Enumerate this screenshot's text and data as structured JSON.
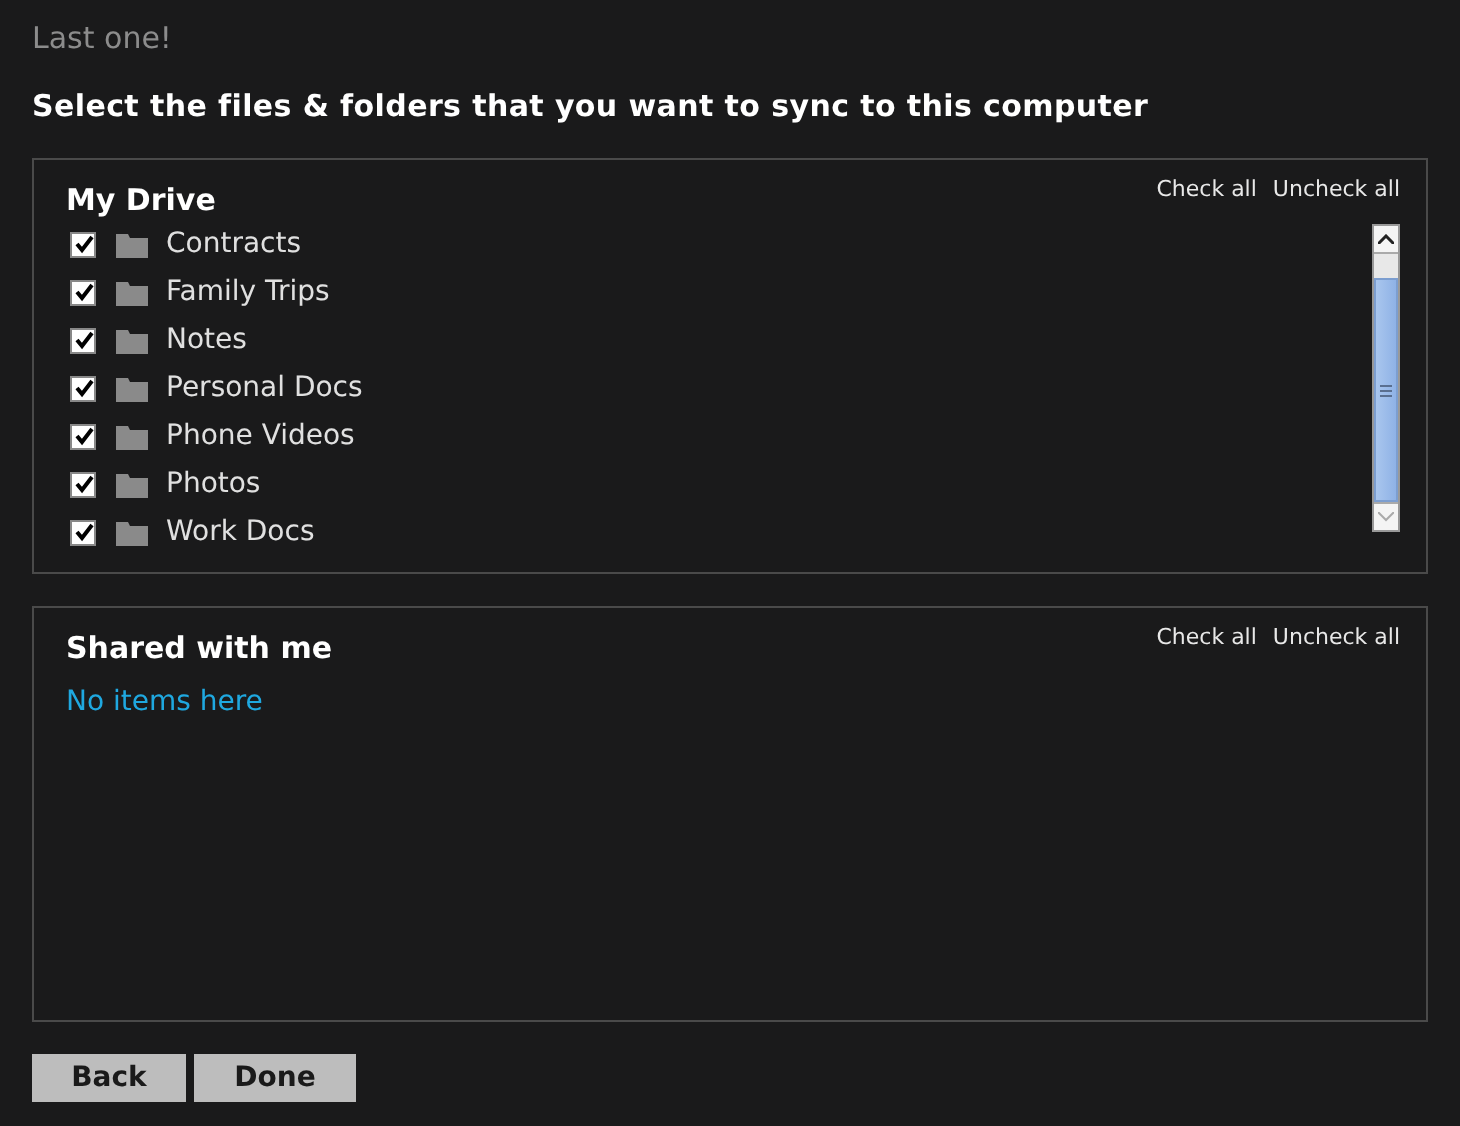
{
  "step_label": "Last one!",
  "heading": "Select the files & folders that you want to sync to this computer",
  "sections": [
    {
      "title": "My Drive",
      "check_all": "Check all",
      "uncheck_all": "Uncheck all",
      "items": [
        {
          "name": "Contracts",
          "checked": true
        },
        {
          "name": "Family Trips",
          "checked": true
        },
        {
          "name": "Notes",
          "checked": true
        },
        {
          "name": "Personal Docs",
          "checked": true
        },
        {
          "name": "Phone Videos",
          "checked": true
        },
        {
          "name": "Photos",
          "checked": true
        },
        {
          "name": "Work Docs",
          "checked": true
        }
      ]
    },
    {
      "title": "Shared with me",
      "check_all": "Check all",
      "uncheck_all": "Uncheck all",
      "empty_message": "No items here"
    }
  ],
  "buttons": [
    {
      "label": "Back"
    },
    {
      "label": "Done"
    }
  ]
}
